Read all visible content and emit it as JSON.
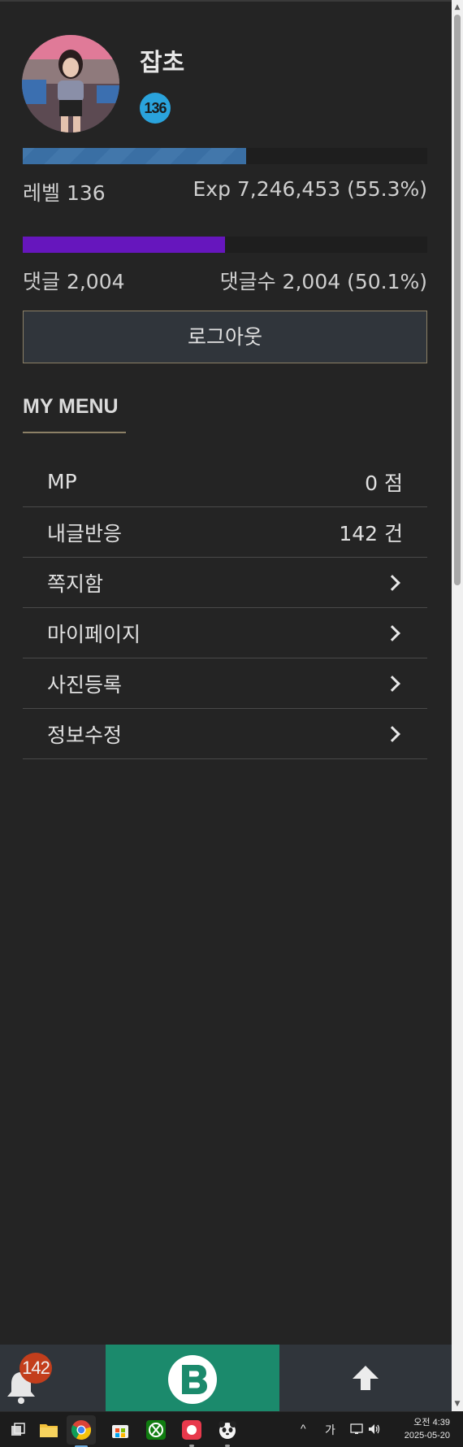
{
  "profile": {
    "username": "잡초",
    "level_badge": "136",
    "exp_fill_pct": 55.3,
    "comment_fill_pct": 50.1,
    "level_text": "레벨 136",
    "exp_text": "Exp 7,246,453 (55.3%)",
    "comment_text": "댓글 2,004",
    "comment_count_text": "댓글수 2,004 (50.1%)"
  },
  "logout_label": "로그아웃",
  "menu": {
    "title": "MY MENU",
    "items": [
      {
        "label": "MP",
        "value": "0 점"
      },
      {
        "label": "내글반응",
        "value": "142 건"
      },
      {
        "label": "쪽지함",
        "icon": "chevron-right-icon"
      },
      {
        "label": "마이페이지",
        "icon": "chevron-right-icon"
      },
      {
        "label": "사진등록",
        "icon": "chevron-right-icon"
      },
      {
        "label": "정보수정",
        "icon": "chevron-right-icon"
      }
    ]
  },
  "bottom_bar": {
    "notification_count": "142",
    "logo_icon": "b-logo-icon",
    "scroll_top_icon": "arrow-up-icon"
  },
  "taskbar": {
    "ime_label": "가",
    "time": "오전 4:39",
    "date": "2025-05-20"
  },
  "colors": {
    "background": "#242424",
    "accent_gold": "#8c8066",
    "exp_bar": "#3a6fa4",
    "comment_bar": "#6616bd",
    "level_badge": "#2aa3dc",
    "notification_badge": "#c33e1c",
    "logo_green": "#1b8a6c"
  }
}
